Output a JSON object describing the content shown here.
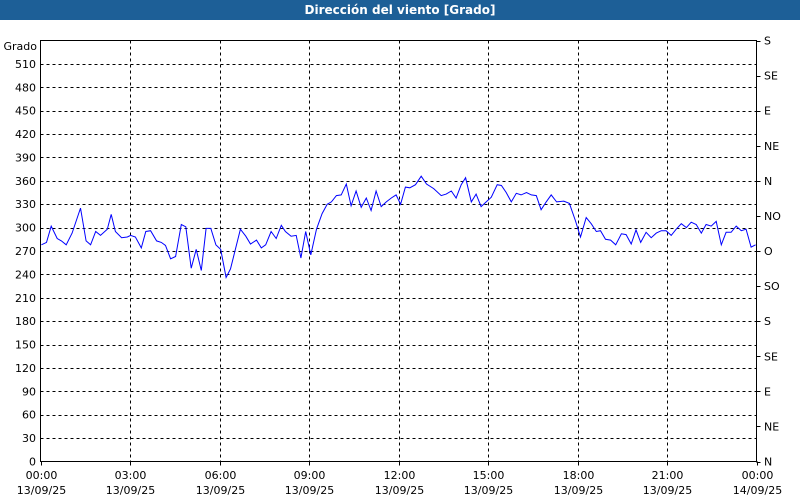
{
  "chart_data": {
    "type": "line",
    "title": "Dirección del viento [Grado]",
    "ylabel": "Grado",
    "ylim": [
      0,
      540
    ],
    "yticks": [
      0,
      30,
      60,
      90,
      120,
      150,
      180,
      210,
      240,
      270,
      300,
      330,
      360,
      390,
      420,
      450,
      480,
      510
    ],
    "right_axis": {
      "ticks": [
        {
          "value": 0,
          "label": "N"
        },
        {
          "value": 45,
          "label": "NE"
        },
        {
          "value": 90,
          "label": "E"
        },
        {
          "value": 135,
          "label": "SE"
        },
        {
          "value": 180,
          "label": "S"
        },
        {
          "value": 225,
          "label": "SO"
        },
        {
          "value": 270,
          "label": "O"
        },
        {
          "value": 315,
          "label": "NO"
        },
        {
          "value": 360,
          "label": "N"
        },
        {
          "value": 405,
          "label": "NE"
        },
        {
          "value": 450,
          "label": "E"
        },
        {
          "value": 495,
          "label": "SE"
        },
        {
          "value": 540,
          "label": "S"
        }
      ]
    },
    "xlim_hours": [
      0,
      24
    ],
    "xticks": [
      {
        "hour": 0,
        "time": "00:00",
        "date": "13/09/25"
      },
      {
        "hour": 3,
        "time": "03:00",
        "date": "13/09/25"
      },
      {
        "hour": 6,
        "time": "06:00",
        "date": "13/09/25"
      },
      {
        "hour": 9,
        "time": "09:00",
        "date": "13/09/25"
      },
      {
        "hour": 12,
        "time": "12:00",
        "date": "13/09/25"
      },
      {
        "hour": 15,
        "time": "15:00",
        "date": "13/09/25"
      },
      {
        "hour": 18,
        "time": "18:00",
        "date": "13/09/25"
      },
      {
        "hour": 21,
        "time": "21:00",
        "date": "13/09/25"
      },
      {
        "hour": 24,
        "time": "00:00",
        "date": "14/09/25"
      }
    ],
    "grid": true,
    "line_color": "#0000ff",
    "series": [
      {
        "name": "Dirección del viento",
        "points": [
          [
            0.03,
            278
          ],
          [
            0.2,
            281
          ],
          [
            0.36,
            302
          ],
          [
            0.56,
            286
          ],
          [
            0.7,
            283
          ],
          [
            0.86,
            278
          ],
          [
            1.06,
            293
          ],
          [
            1.34,
            325
          ],
          [
            1.53,
            283
          ],
          [
            1.68,
            278
          ],
          [
            1.85,
            295
          ],
          [
            2.01,
            290
          ],
          [
            2.24,
            298
          ],
          [
            2.37,
            317
          ],
          [
            2.51,
            295
          ],
          [
            2.72,
            287
          ],
          [
            2.91,
            288
          ],
          [
            3.02,
            290
          ],
          [
            3.18,
            288
          ],
          [
            3.38,
            274
          ],
          [
            3.53,
            295
          ],
          [
            3.69,
            296
          ],
          [
            3.89,
            283
          ],
          [
            4.05,
            281
          ],
          [
            4.19,
            277
          ],
          [
            4.36,
            260
          ],
          [
            4.53,
            263
          ],
          [
            4.72,
            304
          ],
          [
            4.87,
            301
          ],
          [
            5.05,
            248
          ],
          [
            5.22,
            272
          ],
          [
            5.39,
            245
          ],
          [
            5.55,
            299
          ],
          [
            5.71,
            299
          ],
          [
            5.88,
            278
          ],
          [
            6.04,
            272
          ],
          [
            6.22,
            236
          ],
          [
            6.37,
            247
          ],
          [
            6.7,
            298
          ],
          [
            6.88,
            289
          ],
          [
            7.04,
            279
          ],
          [
            7.24,
            284
          ],
          [
            7.4,
            274
          ],
          [
            7.55,
            278
          ],
          [
            7.73,
            295
          ],
          [
            7.9,
            286
          ],
          [
            8.07,
            303
          ],
          [
            8.21,
            295
          ],
          [
            8.4,
            289
          ],
          [
            8.57,
            290
          ],
          [
            8.73,
            261
          ],
          [
            8.89,
            295
          ],
          [
            9.06,
            265
          ],
          [
            9.25,
            298
          ],
          [
            9.44,
            318
          ],
          [
            9.61,
            330
          ],
          [
            9.75,
            333
          ],
          [
            9.92,
            341
          ],
          [
            10.08,
            342
          ],
          [
            10.25,
            356
          ],
          [
            10.41,
            328
          ],
          [
            10.58,
            347
          ],
          [
            10.75,
            326
          ],
          [
            10.92,
            338
          ],
          [
            11.08,
            322
          ],
          [
            11.25,
            347
          ],
          [
            11.42,
            327
          ],
          [
            11.59,
            333
          ],
          [
            11.76,
            338
          ],
          [
            11.92,
            342
          ],
          [
            12.07,
            330
          ],
          [
            12.23,
            352
          ],
          [
            12.38,
            351
          ],
          [
            12.57,
            355
          ],
          [
            12.76,
            366
          ],
          [
            12.94,
            356
          ],
          [
            13.18,
            350
          ],
          [
            13.43,
            341
          ],
          [
            13.6,
            343
          ],
          [
            13.77,
            347
          ],
          [
            13.93,
            338
          ],
          [
            14.1,
            355
          ],
          [
            14.25,
            364
          ],
          [
            14.44,
            333
          ],
          [
            14.6,
            343
          ],
          [
            14.77,
            327
          ],
          [
            14.94,
            333
          ],
          [
            15.11,
            339
          ],
          [
            15.31,
            355
          ],
          [
            15.45,
            354
          ],
          [
            15.61,
            345
          ],
          [
            15.78,
            333
          ],
          [
            15.95,
            344
          ],
          [
            16.11,
            342
          ],
          [
            16.29,
            345
          ],
          [
            16.45,
            342
          ],
          [
            16.62,
            341
          ],
          [
            16.78,
            323
          ],
          [
            16.95,
            333
          ],
          [
            17.12,
            342
          ],
          [
            17.3,
            333
          ],
          [
            17.54,
            334
          ],
          [
            17.73,
            331
          ],
          [
            17.93,
            309
          ],
          [
            18.1,
            288
          ],
          [
            18.29,
            313
          ],
          [
            18.46,
            305
          ],
          [
            18.63,
            295
          ],
          [
            18.77,
            296
          ],
          [
            18.94,
            285
          ],
          [
            19.11,
            284
          ],
          [
            19.28,
            278
          ],
          [
            19.47,
            292
          ],
          [
            19.63,
            291
          ],
          [
            19.8,
            279
          ],
          [
            19.96,
            297
          ],
          [
            20.12,
            281
          ],
          [
            20.3,
            294
          ],
          [
            20.47,
            287
          ],
          [
            20.64,
            293
          ],
          [
            20.81,
            296
          ],
          [
            20.97,
            296
          ],
          [
            21.14,
            290
          ],
          [
            21.31,
            298
          ],
          [
            21.48,
            305
          ],
          [
            21.65,
            300
          ],
          [
            21.81,
            307
          ],
          [
            21.98,
            304
          ],
          [
            22.15,
            293
          ],
          [
            22.31,
            304
          ],
          [
            22.48,
            302
          ],
          [
            22.65,
            308
          ],
          [
            22.82,
            278
          ],
          [
            22.98,
            294
          ],
          [
            23.15,
            294
          ],
          [
            23.32,
            302
          ],
          [
            23.49,
            296
          ],
          [
            23.65,
            298
          ],
          [
            23.82,
            275
          ],
          [
            23.97,
            278
          ]
        ]
      }
    ]
  }
}
